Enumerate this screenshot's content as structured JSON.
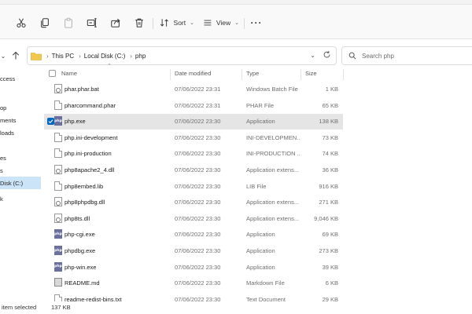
{
  "toolbar": {
    "sort_label": "Sort",
    "view_label": "View"
  },
  "address": {
    "crumbs": [
      "This PC",
      "Local Disk (C:)",
      "php"
    ]
  },
  "search": {
    "placeholder": "Search php"
  },
  "sidebar": {
    "items": [
      "ccess",
      "op",
      "ments",
      "loads",
      "es",
      "s",
      "Disk (C:)",
      "k"
    ]
  },
  "columns": {
    "name": "Name",
    "date": "Date modified",
    "type": "Type",
    "size": "Size"
  },
  "files": [
    {
      "name": "phar.phar.bat",
      "date": "07/06/2022 23:31",
      "type": "Windows Batch File",
      "size": "1 KB",
      "icon": "gear-doc"
    },
    {
      "name": "pharcommand.phar",
      "date": "07/06/2022 23:31",
      "type": "PHAR File",
      "size": "65 KB",
      "icon": "doc"
    },
    {
      "name": "php.exe",
      "date": "07/06/2022 23:30",
      "type": "Application",
      "size": "138 KB",
      "icon": "php",
      "selected": true
    },
    {
      "name": "php.ini-development",
      "date": "07/06/2022 23:30",
      "type": "INI-DEVELOPMEN...",
      "size": "73 KB",
      "icon": "doc"
    },
    {
      "name": "php.ini-production",
      "date": "07/06/2022 23:30",
      "type": "INI-PRODUCTION ...",
      "size": "74 KB",
      "icon": "doc"
    },
    {
      "name": "php8apache2_4.dll",
      "date": "07/06/2022 23:30",
      "type": "Application extens...",
      "size": "36 KB",
      "icon": "gear-doc"
    },
    {
      "name": "php8embed.lib",
      "date": "07/06/2022 23:30",
      "type": "LIB File",
      "size": "916 KB",
      "icon": "doc"
    },
    {
      "name": "php8phpdbg.dll",
      "date": "07/06/2022 23:30",
      "type": "Application extens...",
      "size": "271 KB",
      "icon": "gear-doc"
    },
    {
      "name": "php8ts.dll",
      "date": "07/06/2022 23:30",
      "type": "Application extens...",
      "size": "9,046 KB",
      "icon": "gear-doc"
    },
    {
      "name": "php-cgi.exe",
      "date": "07/06/2022 23:30",
      "type": "Application",
      "size": "69 KB",
      "icon": "php"
    },
    {
      "name": "phpdbg.exe",
      "date": "07/06/2022 23:30",
      "type": "Application",
      "size": "273 KB",
      "icon": "php"
    },
    {
      "name": "php-win.exe",
      "date": "07/06/2022 23:30",
      "type": "Application",
      "size": "39 KB",
      "icon": "php"
    },
    {
      "name": "README.md",
      "date": "07/06/2022 23:30",
      "type": "Markdown File",
      "size": "6 KB",
      "icon": "md"
    },
    {
      "name": "readme-redist-bins.txt",
      "date": "07/06/2022 23:30",
      "type": "Text Document",
      "size": "29 KB",
      "icon": "doc"
    }
  ],
  "status": {
    "selection": "item selected",
    "size": "137 KB"
  },
  "colors": {
    "accent": "#0067c0",
    "selected_row": "#e5e5e5",
    "sidebar_selected": "#cce4f7"
  }
}
